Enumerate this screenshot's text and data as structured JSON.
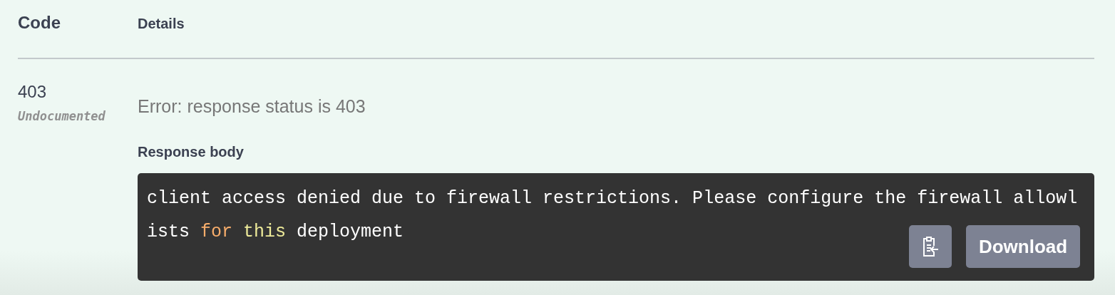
{
  "columns": [
    "Code",
    "Details"
  ],
  "response": {
    "code": "403",
    "code_note": "Undocumented",
    "error": "Error: response status is 403",
    "body_label": "Response body",
    "body_lines": [
      [
        {
          "text": "client access denied due to firewall restrictions. Please configure the firewall allowl",
          "kind": "plain"
        }
      ],
      [
        {
          "text": "ists ",
          "kind": "plain"
        },
        {
          "text": "for ",
          "kind": "keyword"
        },
        {
          "text": "this",
          "kind": "builtin"
        },
        {
          "text": " deployment",
          "kind": "plain"
        }
      ]
    ],
    "download": "Download"
  }
}
